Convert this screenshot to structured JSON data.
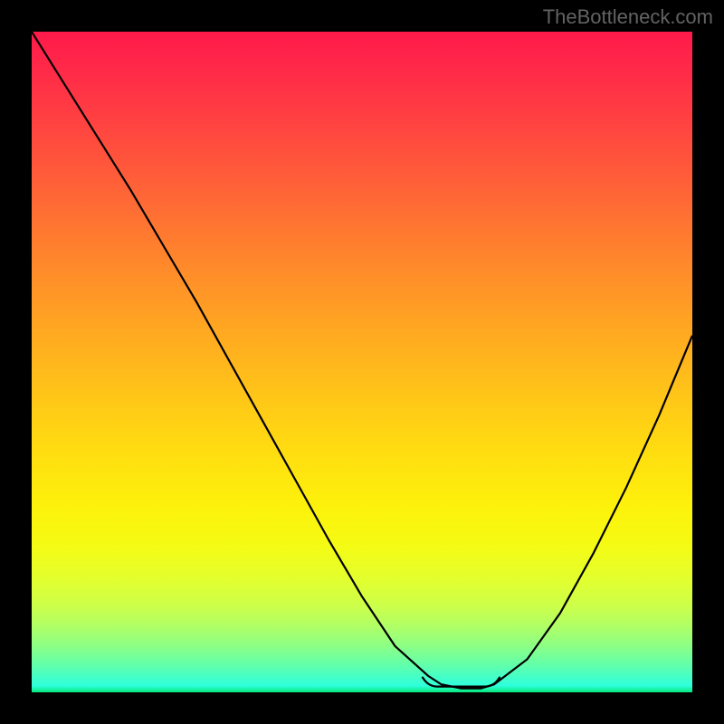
{
  "watermark": "TheBottleneck.com",
  "chart_data": {
    "type": "line",
    "title": "",
    "xlabel": "",
    "ylabel": "",
    "xlim": [
      0,
      100
    ],
    "ylim": [
      0,
      100
    ],
    "series": [
      {
        "name": "curve",
        "x": [
          0,
          5,
          10,
          15,
          20,
          25,
          30,
          35,
          40,
          45,
          50,
          55,
          60,
          62,
          65,
          68,
          70,
          75,
          80,
          85,
          90,
          95,
          100
        ],
        "y": [
          100,
          92,
          84,
          76,
          67.5,
          59,
          50,
          41,
          32,
          23,
          14.5,
          7,
          2.5,
          1.2,
          0.6,
          0.6,
          1.2,
          5,
          12,
          21,
          31,
          42,
          54
        ]
      }
    ],
    "annotations": [
      {
        "name": "flat-bottom-marker",
        "x_range": [
          60,
          70
        ],
        "y": 0.6,
        "color": "#c06058"
      }
    ],
    "background_gradient": {
      "direction": "top-to-bottom",
      "stops": [
        {
          "pos": 0,
          "color": "#ff1a4a"
        },
        {
          "pos": 50,
          "color": "#ffc518"
        },
        {
          "pos": 75,
          "color": "#fdf20b"
        },
        {
          "pos": 100,
          "color": "#06e87a"
        }
      ]
    }
  }
}
